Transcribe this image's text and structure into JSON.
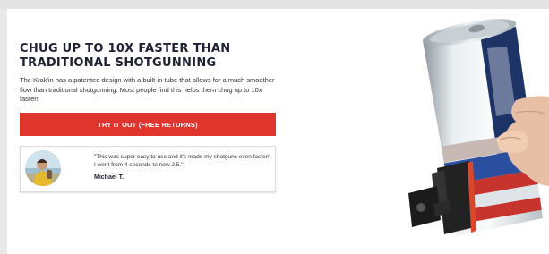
{
  "section": {
    "headline": "CHUG UP TO 10X FASTER THAN TRADITIONAL SHOTGUNNING",
    "description": "The Krak'in has a patented design with a built-in tube that allows for a much smoother flow than traditional shotgunning. Most people find this helps them chug up to 10x faster!"
  },
  "cta": {
    "label": "TRY IT OUT (FREE RETURNS)",
    "color": "#e0352c"
  },
  "testimonial": {
    "quote": "\"This was super easy to use and it's made my shotguns even faster! I went from 4 seconds to now 2.5.\"",
    "author": "Michael T."
  },
  "colors": {
    "headline": "#1f2233",
    "background": "#ffffff",
    "page_edge": "#e9e9e9"
  },
  "icons": {
    "avatar": "customer-photo",
    "product": "beer-can-with-krakin-device-held-in-hand"
  }
}
